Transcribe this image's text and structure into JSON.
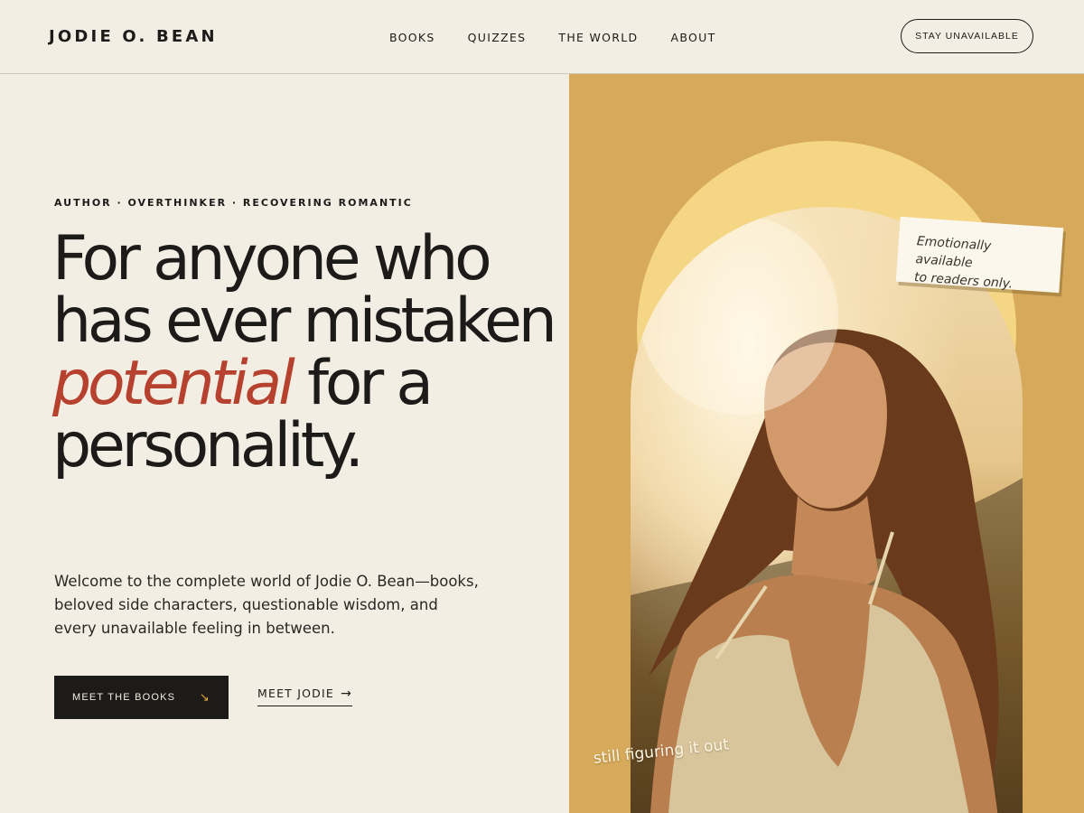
{
  "brand": {
    "logo": "JODIE O. BEAN"
  },
  "nav": {
    "items": [
      {
        "label": "BOOKS"
      },
      {
        "label": "QUIZZES"
      },
      {
        "label": "THE WORLD"
      },
      {
        "label": "ABOUT"
      }
    ],
    "cta_label": "STAY UNAVAILABLE"
  },
  "hero": {
    "eyebrow": "AUTHOR · OVERTHINKER · RECOVERING ROMANTIC",
    "headline_before": "For anyone who has ever mistaken",
    "headline_accent": "potential",
    "headline_after": "for a personality.",
    "lede": "Welcome to the complete world of Jodie O. Bean—books, beloved side characters, questionable wisdom, and every unavailable feeling in between.",
    "primary_button": {
      "label": "MEET THE BOOKS",
      "arrow": "↘"
    },
    "secondary_link": {
      "label": "MEET JODIE",
      "arrow": "→"
    }
  },
  "visual": {
    "sticky_note": {
      "line1": "Emotionally available",
      "line2": "to readers only."
    },
    "scribble": "still figuring it out",
    "photo_alt": "portrait-of-woman-in-sunlight"
  },
  "colors": {
    "background": "#f3eee4",
    "ink": "#1c1b19",
    "accent": "#b5412e",
    "panel": "#d6a95b",
    "sun": "#f4d685",
    "arrow_accent": "#e3a93a"
  }
}
